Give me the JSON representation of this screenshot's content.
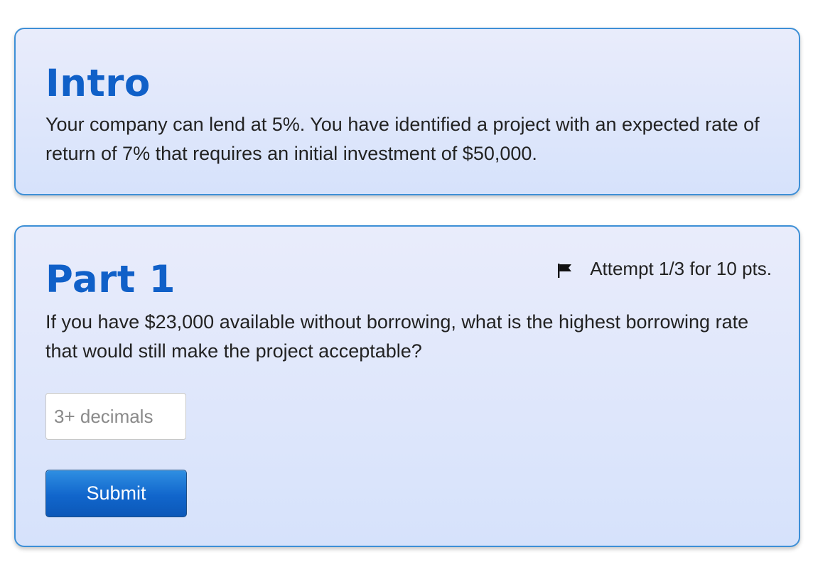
{
  "intro": {
    "title": "Intro",
    "text": "Your company can lend at 5%. You have identified a project with an expected rate of return of 7% that requires an initial investment of $50,000."
  },
  "part1": {
    "title": "Part 1",
    "attempt_icon": "flag-icon",
    "attempt_text": "Attempt 1/3 for 10 pts.",
    "question": "If you have $23,000 available without borrowing, what is the highest borrowing rate that would still make the project acceptable?",
    "answer": {
      "value": "",
      "placeholder": "3+ decimals"
    },
    "submit_label": "Submit"
  },
  "colors": {
    "heading": "#1060c8",
    "card_border": "#3d8fd6",
    "card_bg_top": "#e9ecfb",
    "card_bg_bottom": "#d6e2fb",
    "button": "#1166cc"
  }
}
